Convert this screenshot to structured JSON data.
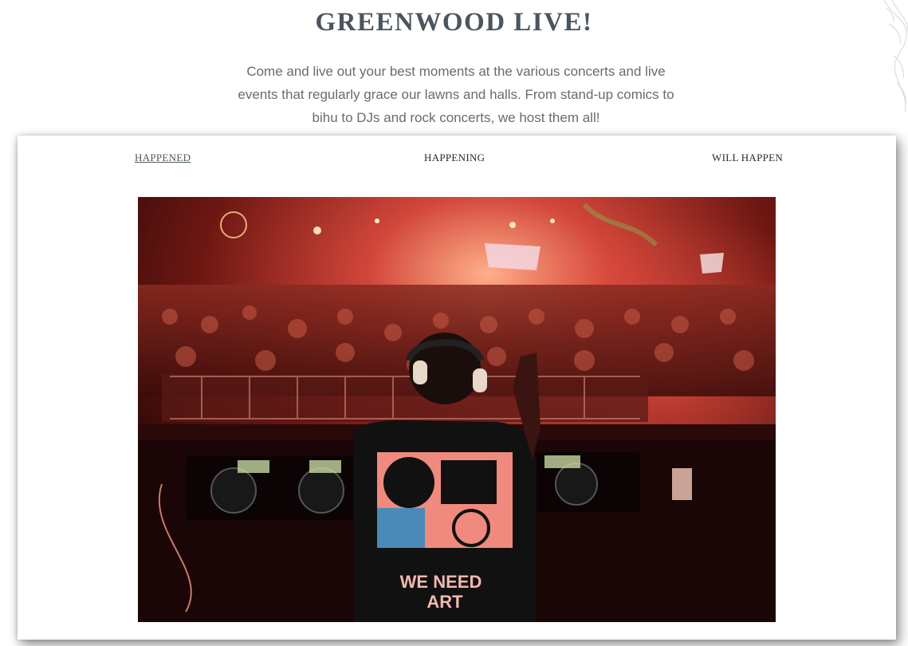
{
  "page": {
    "title": "GREENWOOD LIVE!",
    "intro_lines": [
      "Come and live out your best moments at the various concerts and live",
      "events that regularly grace our lawns and halls. From stand-up comics to",
      "bihu to DJs and rock concerts, we host them all!"
    ]
  },
  "tabs": [
    {
      "label": "HAPPENED",
      "active": true
    },
    {
      "label": "HAPPENING",
      "active": false
    },
    {
      "label": "WILL HAPPEN",
      "active": false
    }
  ],
  "photo": {
    "subject": "dj-performing-at-night-concert",
    "shirt_text_line1": "WE NEED",
    "shirt_text_line2": "ART"
  },
  "colors": {
    "title": "#4a5560",
    "text": "#6b6b6b",
    "tab": "#1f2a2a",
    "tab_active": "#4e5a5e",
    "stage_red": "#d2463a"
  }
}
